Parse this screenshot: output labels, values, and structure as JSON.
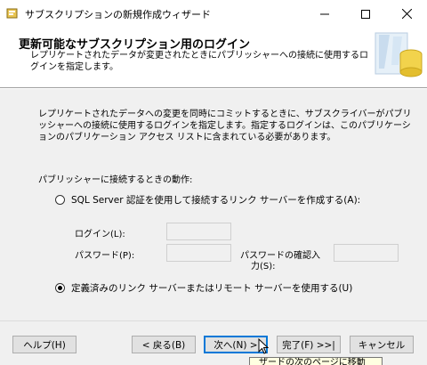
{
  "window": {
    "title": "サブスクリプションの新規作成ウィザード",
    "minimize_icon": "minimize-icon",
    "maximize_icon": "maximize-icon",
    "close_icon": "close-icon"
  },
  "header": {
    "title": "更新可能なサブスクリプション用のログイン",
    "description": "レプリケートされたデータが変更されたときにパブリッシャーへの接続に使用するログインを指定します。",
    "graphic_icon": "database-wizard-graphic"
  },
  "main": {
    "description": "レプリケートされたデータへの変更を同時にコミットするときに、サブスクライバーがパブリッシャーへの接続に使用するログインを指定します。指定するログインは、このパブリケーションのパブリケーション アクセス リストに含まれている必要があります。",
    "behavior_label": "パブリッシャーに接続するときの動作:",
    "option_sql": {
      "label": "SQL Server 認証を使用して接続するリンク サーバーを作成する(A):",
      "selected": false
    },
    "login_label": "ログイン(L):",
    "login_value": "",
    "password_label": "パスワード(P):",
    "password_value": "",
    "confirm_label_line1": "パスワードの確認入",
    "confirm_label_line2": "力(S):",
    "confirm_value": "",
    "option_linked": {
      "label": "定義済みのリンク サーバーまたはリモート サーバーを使用する(U)",
      "selected": true
    }
  },
  "buttons": {
    "help": "ヘルプ(H)",
    "back": "< 戻る(B)",
    "next": "次へ(N) >",
    "finish": "完了(F) >>|",
    "cancel": "キャンセル"
  },
  "tooltip": "ザードの次のページに移動",
  "colors": {
    "window_bg": "#f0f0f0",
    "accent": "#0078d7",
    "tooltip_bg": "#ffffe1"
  }
}
